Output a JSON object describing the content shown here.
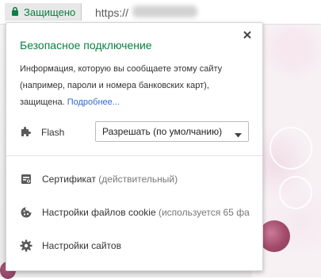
{
  "addressbar": {
    "secure_label": "Защищено",
    "url_visible": "https://"
  },
  "popup": {
    "title": "Безопасное подключение",
    "description": "Информация, которую вы сообщаете этому сайту (например, пароли и номера банковских карт), защищена.",
    "more_link": "Подробнее...",
    "flash": {
      "label": "Flash",
      "select_value": "Разрешать (по умолчанию)"
    },
    "items": [
      {
        "label": "Сертификат",
        "detail": "(действительный)",
        "icon": "certificate-icon"
      },
      {
        "label": "Настройки файлов cookie",
        "detail": "(используется 65 фа",
        "icon": "cookie-icon"
      },
      {
        "label": "Настройки сайтов",
        "detail": "",
        "icon": "gear-icon"
      }
    ]
  },
  "colors": {
    "secure_green": "#0b8043",
    "link_blue": "#3367d6"
  }
}
